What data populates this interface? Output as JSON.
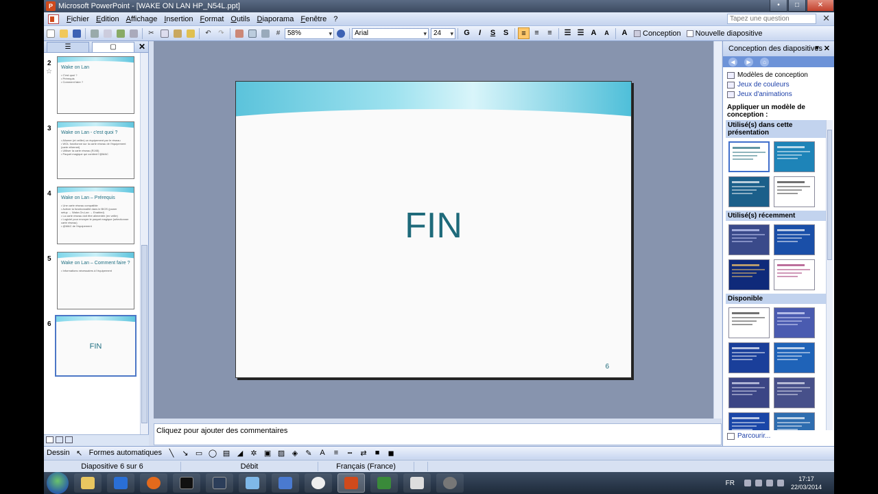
{
  "window": {
    "title": "Microsoft PowerPoint - [WAKE ON LAN HP_N54L.ppt]",
    "buttons": [
      "•",
      "□",
      "✕"
    ]
  },
  "menubar": {
    "items": [
      "Fichier",
      "Edition",
      "Affichage",
      "Insertion",
      "Format",
      "Outils",
      "Diaporama",
      "Fenêtre",
      "?"
    ],
    "help_placeholder": "Tapez une question",
    "close": "✕"
  },
  "toolbar": {
    "zoom": "58%",
    "font": "Arial",
    "size": "24",
    "bold": "G",
    "italic": "I",
    "underline": "S",
    "shadow": "S",
    "design_label": "Conception",
    "new_slide_label": "Nouvelle diapositive",
    "font_color": "A"
  },
  "left_panel": {
    "close": "✕",
    "slides": [
      {
        "num": "2",
        "title": "Wake on Lan",
        "bullets": [
          "• C'est quoi ?",
          "• Prérequis",
          "• Comment faire ?"
        ],
        "star": "☆"
      },
      {
        "num": "3",
        "title": "Wake on Lan - c'est quoi ?",
        "bullets": [
          "• Allumer (et veiller) un équipement par le réseau",
          "• WOL fonctionne sur la carte réseau de l'équipement",
          "  (carte ethernet)",
          "• Utiliser la carte réseau (RJ45)",
          "• Paquet magique qui contient l'@MAC"
        ]
      },
      {
        "num": "4",
        "title": "Wake on Lan – Prérequis",
        "bullets": [
          "• Une carte réseau compatible",
          "• Activer la fonctionnalité dans le BIOS (power management",
          "  setup → Wake-On-Lan → Enabled)",
          "• La carte réseau doit être alimentée (en veille)",
          "• Logiciel pour envoyer le paquet magique (sélectionner",
          "  carte réseau)",
          "• @MAC de l'équipement"
        ]
      },
      {
        "num": "5",
        "title": "Wake on Lan – Comment faire ?",
        "bullets": [
          "• Informations nécessaires à l'équipement"
        ]
      },
      {
        "num": "6",
        "title": "",
        "fin": "FIN",
        "bullets": []
      }
    ]
  },
  "slide": {
    "title": "FIN",
    "page_number": "6"
  },
  "notes": {
    "placeholder": "Cliquez pour ajouter des commentaires"
  },
  "task_pane": {
    "title": "Conception des diapositives",
    "close": "✕",
    "links": [
      "Modèles de conception",
      "Jeux de couleurs",
      "Jeux d'animations"
    ],
    "apply_label": "Appliquer un modèle de conception :",
    "sections": [
      {
        "label": "Utilisé(s) dans cette présentation",
        "thumbs": [
          {
            "bg": "#ffffff",
            "fg": "#1e6a7a",
            "sel": true
          },
          {
            "bg": "#1e84b8",
            "fg": "#ffffff"
          },
          {
            "bg": "#1b5f8a",
            "fg": "#ffffff"
          },
          {
            "bg": "#ffffff",
            "fg": "#333333"
          }
        ]
      },
      {
        "label": "Utilisé(s) récemment",
        "thumbs": [
          {
            "bg": "#3a4a8a",
            "fg": "#cfd6ff"
          },
          {
            "bg": "#1a4fa8",
            "fg": "#ffffff"
          },
          {
            "bg": "#0f2a7a",
            "fg": "#ffcc66"
          },
          {
            "bg": "#ffffff",
            "fg": "#a03070"
          }
        ]
      },
      {
        "label": "Disponible",
        "thumbs": [
          {
            "bg": "#ffffff",
            "fg": "#333333"
          },
          {
            "bg": "#4a5bb0",
            "fg": "#e0e4ff"
          },
          {
            "bg": "#1a3f9a",
            "fg": "#ffffff"
          },
          {
            "bg": "#1f63b8",
            "fg": "#ffffff"
          },
          {
            "bg": "#3b4585",
            "fg": "#dfe2f5"
          },
          {
            "bg": "#47508a",
            "fg": "#e6e8f5"
          },
          {
            "bg": "#1a46a8",
            "fg": "#ffffff"
          },
          {
            "bg": "#2e6db0",
            "fg": "#ffffff"
          }
        ]
      }
    ],
    "browse": "Parcourir..."
  },
  "drawbar": {
    "draw_label": "Dessin",
    "shapes_label": "Formes automatiques"
  },
  "statusbar": {
    "slide_info": "Diapositive 6 sur 6",
    "design": "Débit",
    "language": "Français (France)"
  },
  "taskbar": {
    "lang": "FR",
    "time": "17:17",
    "date": "22/03/2014"
  },
  "colors": {
    "accent": "#1e6a7a",
    "selection": "#4b76c6",
    "canvas": "#8794ae"
  }
}
